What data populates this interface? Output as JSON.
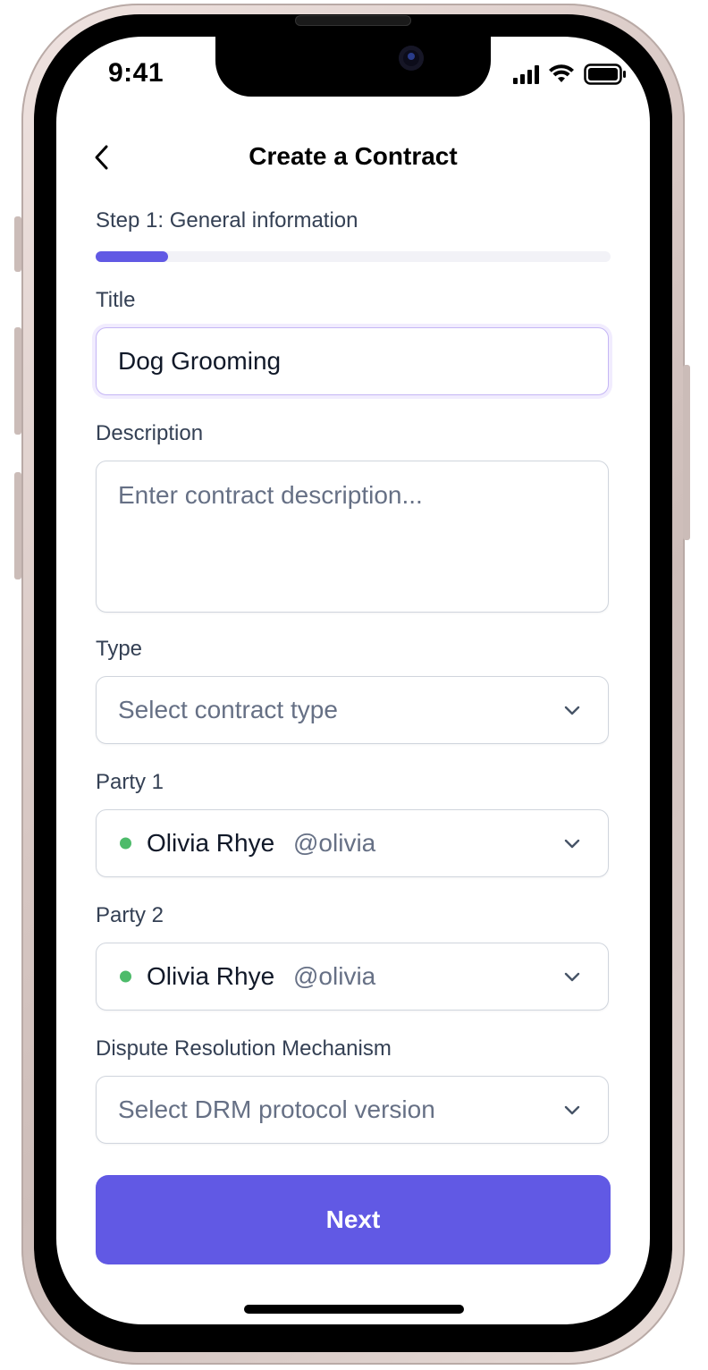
{
  "status_bar": {
    "time": "9:41"
  },
  "header": {
    "title": "Create a Contract"
  },
  "step": {
    "label": "Step 1: General information",
    "progress": 0.14
  },
  "form": {
    "title": {
      "label": "Title",
      "value": "Dog Grooming"
    },
    "description": {
      "label": "Description",
      "placeholder": "Enter contract description..."
    },
    "type": {
      "label": "Type",
      "placeholder": "Select contract type"
    },
    "party1": {
      "label": "Party 1",
      "name": "Olivia Rhye",
      "handle": "@olivia",
      "status_color": "#4dbb6a"
    },
    "party2": {
      "label": "Party 2",
      "name": "Olivia Rhye",
      "handle": "@olivia",
      "status_color": "#4dbb6a"
    },
    "drm": {
      "label": "Dispute Resolution Mechanism",
      "placeholder": "Select DRM protocol version"
    }
  },
  "actions": {
    "next_label": "Next"
  },
  "colors": {
    "accent": "#6159e4",
    "online": "#4dbb6a",
    "label": "#344054",
    "placeholder": "#667085"
  }
}
